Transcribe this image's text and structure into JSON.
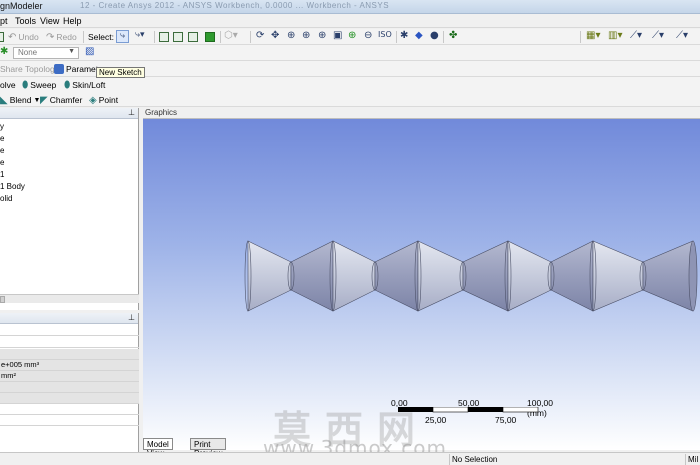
{
  "window": {
    "title": "gnModeler",
    "title_ghost": "12 - Create Ansys 2012 - ANSYS Workbench, 0.0000 ... Workbench - ANSYS"
  },
  "menu": {
    "items": [
      "pt",
      "Tools",
      "View",
      "Help"
    ]
  },
  "toolbar1": {
    "undo": "Undo",
    "redo": "Redo",
    "select_label": "Select:"
  },
  "toolbar2": {
    "plane_value": "None",
    "plane_placeholder": "None"
  },
  "toolbar3": {
    "share_topology": "Share Topology",
    "parameters": "Paramete",
    "tooltip": "New Sketch"
  },
  "toolbar4": {
    "revolve": "olve",
    "sweep": "Sweep",
    "skin_loft": "Skin/Loft"
  },
  "toolbar5": {
    "blend": "Blend",
    "chamfer": "Chamfer",
    "point": "Point"
  },
  "tree": {
    "items": [
      "y",
      "e",
      "e",
      "e",
      "1",
      "1 Body",
      "olid"
    ]
  },
  "details": {
    "rows": [
      "",
      "",
      "",
      "e+005 mm³",
      " mm²",
      "",
      "",
      "",
      ""
    ]
  },
  "graphics": {
    "header": "Graphics",
    "scale": {
      "top_labels": [
        "0,00",
        "50,00",
        "100,00 (mm)"
      ],
      "bottom_labels": [
        "25,00",
        "75,00"
      ]
    }
  },
  "watermark": {
    "chinese": "莫西网",
    "url": "www.3dmox.com"
  },
  "tabs": [
    "Model View",
    "Print Preview"
  ],
  "status": {
    "selection": "No Selection",
    "units": "Mil"
  },
  "colors": {
    "body_light": "#c8cde0",
    "body_dark": "#8e94b4",
    "bg_top": "#6d86d9",
    "bg_bottom": "#ffffff"
  }
}
